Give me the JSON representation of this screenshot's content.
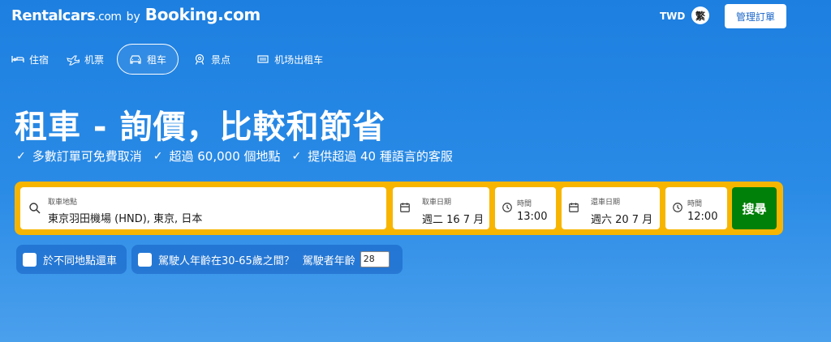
{
  "header": {
    "logo_part1": "Rentalcars",
    "logo_part1_suffix": ".com",
    "logo_by": "by",
    "logo_part2": "Booking.com",
    "currency": "TWD",
    "language": "繁",
    "manage_button": "管理訂單"
  },
  "nav": {
    "items": [
      {
        "label": "住宿",
        "icon": "bed-icon"
      },
      {
        "label": "机票",
        "icon": "plane-icon"
      },
      {
        "label": "租车",
        "icon": "car-icon",
        "active": true
      },
      {
        "label": "景点",
        "icon": "attraction-icon"
      },
      {
        "label": "机场出租车",
        "icon": "taxi-icon"
      }
    ]
  },
  "hero": {
    "title": "租車 - 詢價，比較和節省",
    "benefits": [
      "多數訂單可免費取消",
      "超過 60,000 個地點",
      "提供超過 40 種語言的客服"
    ]
  },
  "search": {
    "location_label": "取車地點",
    "location_value": "東京羽田機場 (HND), 東京, 日本",
    "pickup_date_label": "取車日期",
    "pickup_date_value": "週二 16 7 月",
    "pickup_time_label": "時間",
    "pickup_time_value": "13:00",
    "return_date_label": "還車日期",
    "return_date_value": "週六 20 7 月",
    "return_time_label": "時間",
    "return_time_value": "12:00",
    "search_button": "搜尋"
  },
  "options": {
    "different_return": "於不同地點還車",
    "driver_age_question": "駕駛人年齡在30-65歲之間？",
    "driver_age_label": "駕駛者年齡",
    "driver_age_value": "28"
  },
  "colors": {
    "background": "#1d7fe0",
    "search_bar": "#f7b500",
    "search_button": "#008009"
  }
}
